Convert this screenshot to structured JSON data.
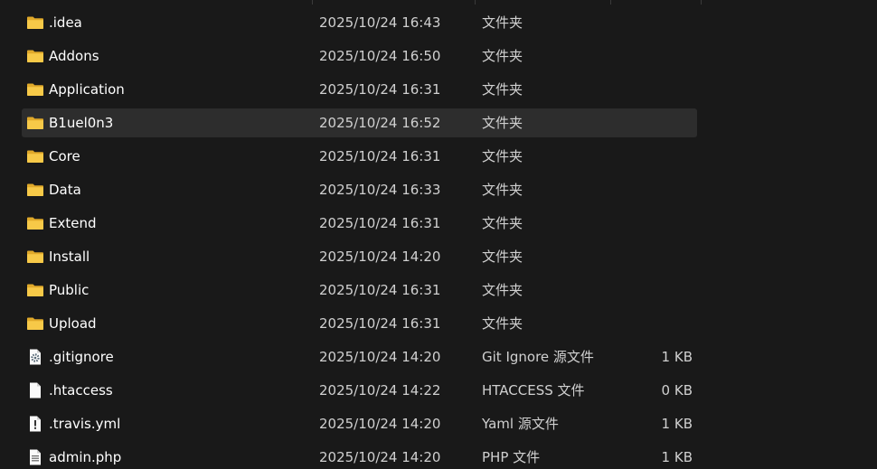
{
  "colors": {
    "background": "#191919",
    "selected_row": "#2d2d2d",
    "folder": "#f7c948",
    "text": "#ffffff"
  },
  "files": [
    {
      "name": ".idea",
      "modified": "2025/10/24 16:43",
      "type": "文件夹",
      "size": "",
      "icon": "folder-icon",
      "selected": false
    },
    {
      "name": "Addons",
      "modified": "2025/10/24 16:50",
      "type": "文件夹",
      "size": "",
      "icon": "folder-icon",
      "selected": false
    },
    {
      "name": "Application",
      "modified": "2025/10/24 16:31",
      "type": "文件夹",
      "size": "",
      "icon": "folder-icon",
      "selected": false
    },
    {
      "name": "B1uel0n3",
      "modified": "2025/10/24 16:52",
      "type": "文件夹",
      "size": "",
      "icon": "folder-icon",
      "selected": true
    },
    {
      "name": "Core",
      "modified": "2025/10/24 16:31",
      "type": "文件夹",
      "size": "",
      "icon": "folder-icon",
      "selected": false
    },
    {
      "name": "Data",
      "modified": "2025/10/24 16:33",
      "type": "文件夹",
      "size": "",
      "icon": "folder-icon",
      "selected": false
    },
    {
      "name": "Extend",
      "modified": "2025/10/24 16:31",
      "type": "文件夹",
      "size": "",
      "icon": "folder-icon",
      "selected": false
    },
    {
      "name": "Install",
      "modified": "2025/10/24 14:20",
      "type": "文件夹",
      "size": "",
      "icon": "folder-icon",
      "selected": false
    },
    {
      "name": "Public",
      "modified": "2025/10/24 16:31",
      "type": "文件夹",
      "size": "",
      "icon": "folder-icon",
      "selected": false
    },
    {
      "name": "Upload",
      "modified": "2025/10/24 16:31",
      "type": "文件夹",
      "size": "",
      "icon": "folder-icon",
      "selected": false
    },
    {
      "name": ".gitignore",
      "modified": "2025/10/24 14:20",
      "type": "Git Ignore 源文件",
      "size": "1 KB",
      "icon": "config-file-icon",
      "selected": false
    },
    {
      "name": ".htaccess",
      "modified": "2025/10/24 14:22",
      "type": "HTACCESS 文件",
      "size": "0 KB",
      "icon": "blank-file-icon",
      "selected": false
    },
    {
      "name": ".travis.yml",
      "modified": "2025/10/24 14:20",
      "type": "Yaml 源文件",
      "size": "1 KB",
      "icon": "warning-file-icon",
      "selected": false
    },
    {
      "name": "admin.php",
      "modified": "2025/10/24 14:20",
      "type": "PHP 文件",
      "size": "1 KB",
      "icon": "text-file-icon",
      "selected": false
    }
  ]
}
